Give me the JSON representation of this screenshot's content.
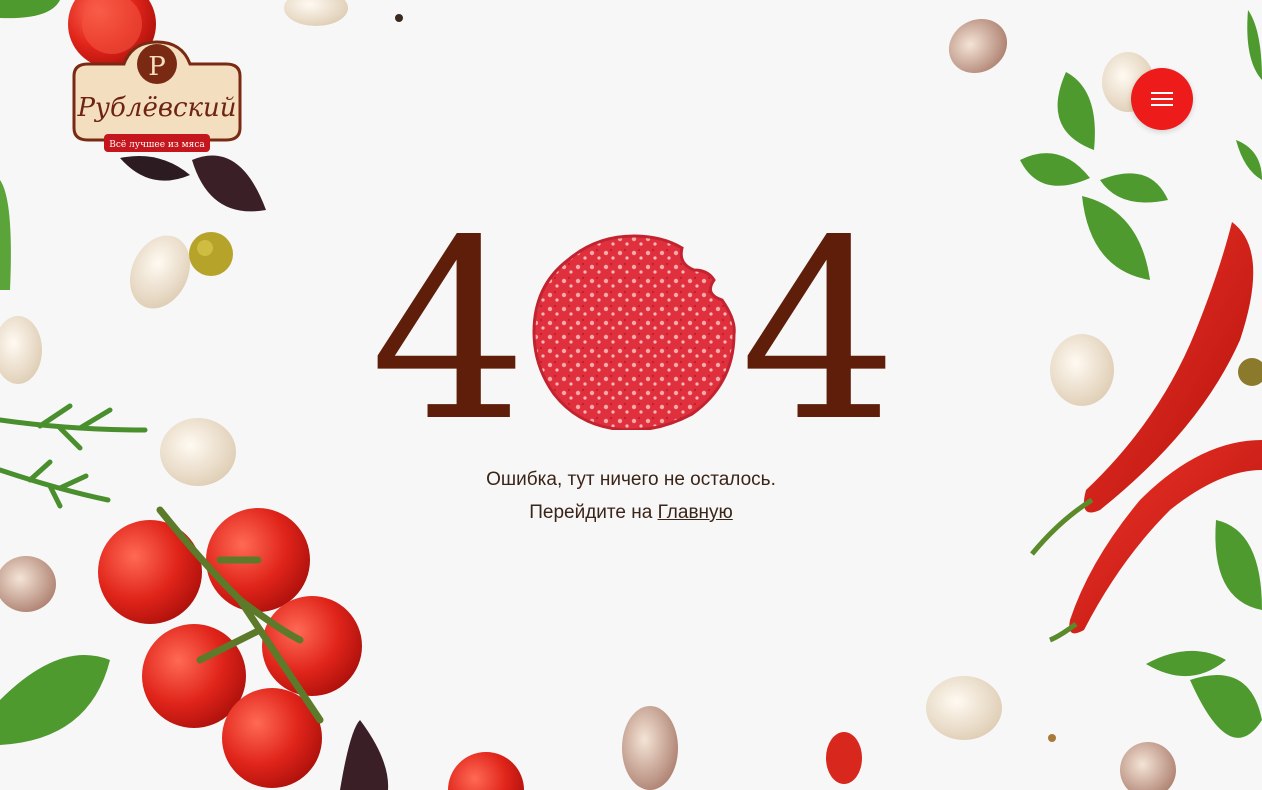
{
  "brand": {
    "name": "Рублёвский",
    "initial": "Р",
    "tagline": "Всё лучшее из мяса"
  },
  "menu": {
    "icon": "hamburger-icon"
  },
  "error": {
    "digit_left": "4",
    "digit_right": "4",
    "message": "Ошибка, тут ничего не осталось.",
    "goto_prefix": "Перейдите на ",
    "home_link": "Главную"
  },
  "colors": {
    "accent": "#ee1b1b",
    "brown": "#5e1e0a",
    "text": "#3b2418",
    "background": "#f7f7f7"
  }
}
